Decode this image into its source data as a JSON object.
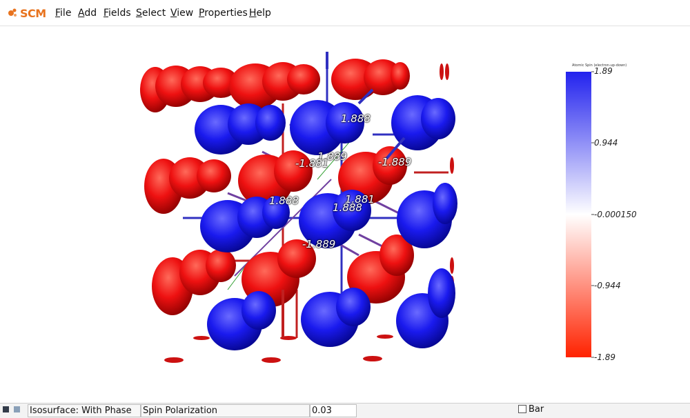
{
  "app": {
    "logo_text": "SCM"
  },
  "menu": {
    "file": {
      "u": "F",
      "rest": "ile"
    },
    "add": {
      "u": "A",
      "rest": "dd"
    },
    "fields": {
      "u": "F",
      "rest": "ields"
    },
    "select": {
      "u": "S",
      "rest": "elect"
    },
    "view": {
      "u": "V",
      "rest": "iew"
    },
    "properties": {
      "u": "P",
      "rest": "roperties"
    },
    "help": {
      "u": "H",
      "rest": "elp"
    }
  },
  "colorbar": {
    "title": "Atomic Spin (electron-up-down)",
    "labels": [
      "1.89",
      "0.944",
      "-0.000150",
      "-0.944",
      "-1.89"
    ],
    "top_color": "#2222ee",
    "mid_color": "#ffffff",
    "bottom_color": "#ff2200"
  },
  "atom_labels": [
    "1.888",
    "1.889",
    "-1.881",
    "-1.889",
    "1.888",
    "1.881",
    "1.888",
    "-1.889"
  ],
  "statusbar": {
    "field": "Isosurface: With Phase",
    "property": "Spin Polarization",
    "value": "0.03",
    "bar_label": "Bar"
  },
  "colors": {
    "spin_up": "#1a1aee",
    "spin_down": "#ee1111",
    "accent": "#e8731e"
  }
}
